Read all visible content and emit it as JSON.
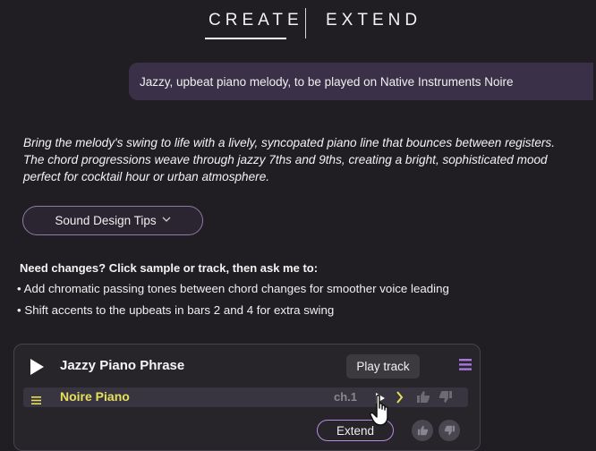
{
  "tabs": [
    {
      "label": "CREATE",
      "active": true
    },
    {
      "label": "EXTEND",
      "active": false
    }
  ],
  "prompt": "Jazzy, upbeat piano melody, to be played on Native Instruments Noire",
  "description": "Bring the melody's swing to life with a lively, syncopated piano line that bounces between registers. The chord progressions weave through jazzy 7ths and 9ths, creating a bright, sophisticated mood perfect for cocktail hour or urban atmosphere.",
  "tips_button": {
    "label": "Sound Design Tips",
    "icon": "chevron-down-icon"
  },
  "changes": {
    "heading": "Need changes? Click sample or track, then ask me to:",
    "suggestions": [
      "• Add chromatic passing tones between chord changes for smoother voice leading",
      "• Shift accents to the upbeats in bars 2 and 4 for extra swing"
    ]
  },
  "track": {
    "title": "Jazzy Piano Phrase",
    "tooltip": "Play track",
    "instrument": "Noire Piano",
    "channel": "ch.1",
    "extend_label": "Extend"
  },
  "colors": {
    "background": "#211e23",
    "accent_purple": "#9b6bd6",
    "instrument_yellow": "#e6e05a",
    "bubble": "#3a3148"
  }
}
